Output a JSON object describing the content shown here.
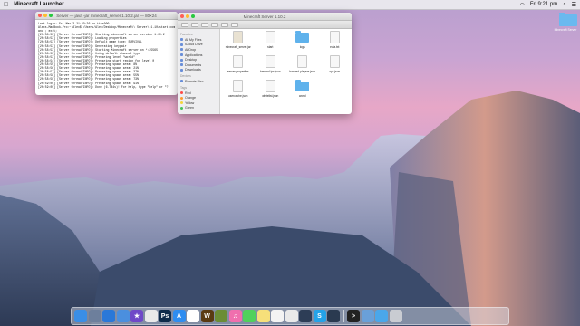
{
  "menubar": {
    "apple_icon": "apple-icon",
    "app_name": "Minecraft Launcher",
    "clock": "Fri 9:21 pm"
  },
  "terminal": {
    "title": "Server — java -jar minecraft_server.1.10.2.jar — 80×24",
    "lines": [
      "Last login: Fri Mar 3 21:09:36 on ttys000",
      "Alexs-MacBook-Pro:~ Alex$ /Users/Alex/Desktop/Minecraft\\ Server\\ 1.10/start.com",
      "and ; exit;",
      "[20:58:53] [Server thread/INFO]: Starting minecraft server version 1.10.2",
      "[20:58:53] [Server thread/INFO]: Loading properties",
      "[20:58:53] [Server thread/INFO]: Default game type: SURVIVAL",
      "[20:58:53] [Server thread/INFO]: Generating keypair",
      "[20:58:53] [Server thread/INFO]: Starting Minecraft server on *:25565",
      "[20:58:53] [Server thread/INFO]: Using default channel type",
      "[20:58:53] [Server thread/INFO]: Preparing level \"world\"",
      "[20:58:54] [Server thread/INFO]: Preparing start region for level 0",
      "[20:58:55] [Server thread/INFO]: Preparing spawn area: 8%",
      "[20:58:56] [Server thread/INFO]: Preparing spawn area: 21%",
      "[20:58:57] [Server thread/INFO]: Preparing spawn area: 37%",
      "[20:58:58] [Server thread/INFO]: Preparing spawn area: 55%",
      "[20:58:59] [Server thread/INFO]: Preparing spawn area: 73%",
      "[20:59:00] [Server thread/INFO]: Preparing spawn area: 91%",
      "[20:59:00] [Server thread/INFO]: Done (6.784s)! For help, type \"help\" or \"?\""
    ]
  },
  "finder": {
    "title": "Minecraft Server 1.10.2",
    "sidebar": {
      "favorites_header": "Favorites",
      "favorites": [
        "All My Files",
        "iCloud Drive",
        "AirDrop",
        "Applications",
        "Desktop",
        "Documents",
        "Downloads"
      ],
      "devices_header": "Devices",
      "devices": [
        "Remote Disc"
      ],
      "tags_header": "Tags",
      "tags": [
        {
          "label": "Red",
          "color": "#ff4b47"
        },
        {
          "label": "Orange",
          "color": "#ff9a2e"
        },
        {
          "label": "Yellow",
          "color": "#f5d53b"
        },
        {
          "label": "Green",
          "color": "#47c25a"
        }
      ]
    },
    "files": [
      {
        "name": "minecraft_server.jar",
        "kind": "jar"
      },
      {
        "name": "start",
        "kind": "doc"
      },
      {
        "name": "logs",
        "kind": "folder"
      },
      {
        "name": "eula.txt",
        "kind": "doc"
      },
      {
        "name": "server.properties",
        "kind": "doc"
      },
      {
        "name": "banned-ips.json",
        "kind": "doc"
      },
      {
        "name": "banned-players.json",
        "kind": "doc"
      },
      {
        "name": "ops.json",
        "kind": "doc"
      },
      {
        "name": "usercache.json",
        "kind": "doc"
      },
      {
        "name": "whitelist.json",
        "kind": "doc"
      },
      {
        "name": "world",
        "kind": "folder"
      }
    ]
  },
  "desktop": {
    "folder_label": "Minecraft Server"
  },
  "dock": {
    "apps": [
      {
        "name": "finder-icon",
        "color": "#3a8ee6",
        "glyph": ""
      },
      {
        "name": "launchpad-icon",
        "color": "#6d7f9c",
        "glyph": ""
      },
      {
        "name": "safari-icon",
        "color": "#2a78d8",
        "glyph": ""
      },
      {
        "name": "mail-icon",
        "color": "#4b8fde",
        "glyph": ""
      },
      {
        "name": "imovie-icon",
        "color": "#6f48c8",
        "glyph": "★"
      },
      {
        "name": "photos-icon",
        "color": "#e9e9e9",
        "glyph": ""
      },
      {
        "name": "photoshop-icon",
        "color": "#0e2b4a",
        "glyph": "Ps"
      },
      {
        "name": "appstore-icon",
        "color": "#2f8df0",
        "glyph": "A"
      },
      {
        "name": "calendar-icon",
        "color": "#ffffff",
        "glyph": ""
      },
      {
        "name": "wow-icon",
        "color": "#5a3a12",
        "glyph": "W"
      },
      {
        "name": "minecraft-icon",
        "color": "#6b8d36",
        "glyph": ""
      },
      {
        "name": "itunes-icon",
        "color": "#f06fae",
        "glyph": "♫"
      },
      {
        "name": "messages-icon",
        "color": "#4fd15c",
        "glyph": ""
      },
      {
        "name": "notes-icon",
        "color": "#f6e07a",
        "glyph": ""
      },
      {
        "name": "reminders-icon",
        "color": "#f3f3f3",
        "glyph": ""
      },
      {
        "name": "chrome-icon",
        "color": "#e9e9e9",
        "glyph": ""
      },
      {
        "name": "steam-icon",
        "color": "#2d3d56",
        "glyph": ""
      },
      {
        "name": "skype-icon",
        "color": "#24a3e8",
        "glyph": "S"
      },
      {
        "name": "quicktime-icon",
        "color": "#2a3a50",
        "glyph": ""
      },
      {
        "name": "terminal-icon",
        "color": "#222222",
        "glyph": ">"
      },
      {
        "name": "preview-icon",
        "color": "#6aa0d8",
        "glyph": ""
      },
      {
        "name": "downloads-icon",
        "color": "#4aa7ea",
        "glyph": ""
      },
      {
        "name": "trash-icon",
        "color": "#c9ccd2",
        "glyph": ""
      }
    ]
  }
}
